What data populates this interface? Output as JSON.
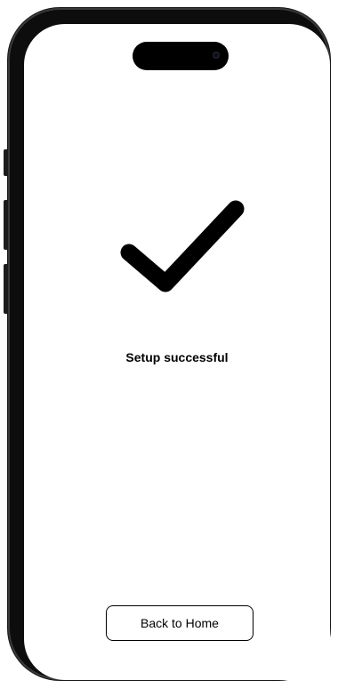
{
  "status": {
    "icon": "checkmark-icon",
    "message": "Setup successful"
  },
  "actions": {
    "home_label": "Back to Home"
  },
  "colors": {
    "frame": "#0d0d0d",
    "screen_background": "#ffffff",
    "foreground": "#000000"
  }
}
